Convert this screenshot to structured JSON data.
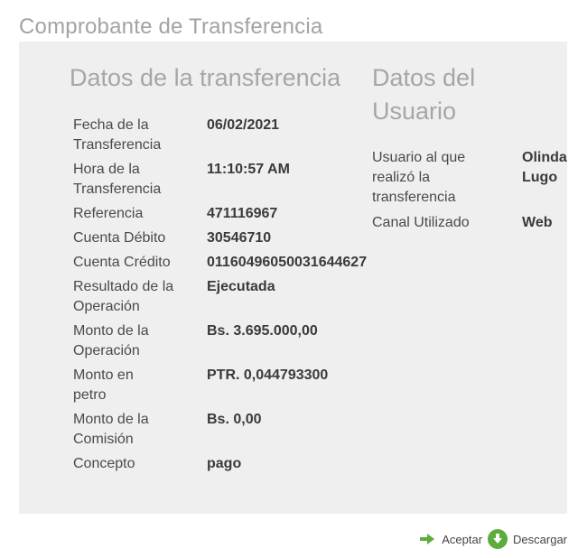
{
  "page": {
    "title": "Comprobante de Transferencia"
  },
  "transfer": {
    "title": "Datos de la transferencia",
    "rows": [
      {
        "label": "Fecha de la Transferencia",
        "value": "06/02/2021"
      },
      {
        "label": "Hora de la Transferencia",
        "value": "11:10:57 AM"
      },
      {
        "label": "Referencia",
        "value": "471116967"
      },
      {
        "label": "Cuenta Débito",
        "value": "30546710"
      },
      {
        "label": "Cuenta Crédito",
        "value": "01160496050031644627"
      },
      {
        "label": "Resultado de la Operación",
        "value": "Ejecutada"
      },
      {
        "label": "Monto de la Operación",
        "value": "Bs. 3.695.000,00"
      },
      {
        "label": "Monto en petro",
        "value": "PTR. 0,044793300"
      },
      {
        "label": "Monto de la Comisión",
        "value": "Bs. 0,00"
      },
      {
        "label": "Concepto",
        "value": "pago"
      }
    ]
  },
  "user": {
    "title": "Datos del Usuario",
    "rows": [
      {
        "label": "Usuario al que realizó la transferencia",
        "value": "Olinda Lugo"
      },
      {
        "label": "Canal Utilizado",
        "value": "Web"
      }
    ]
  },
  "actions": {
    "accept_label": "Aceptar",
    "download_label": "Descargar",
    "accent_color": "#5cad3c",
    "accept_icon": "arrow-right-icon",
    "download_icon": "download-circle-icon"
  }
}
